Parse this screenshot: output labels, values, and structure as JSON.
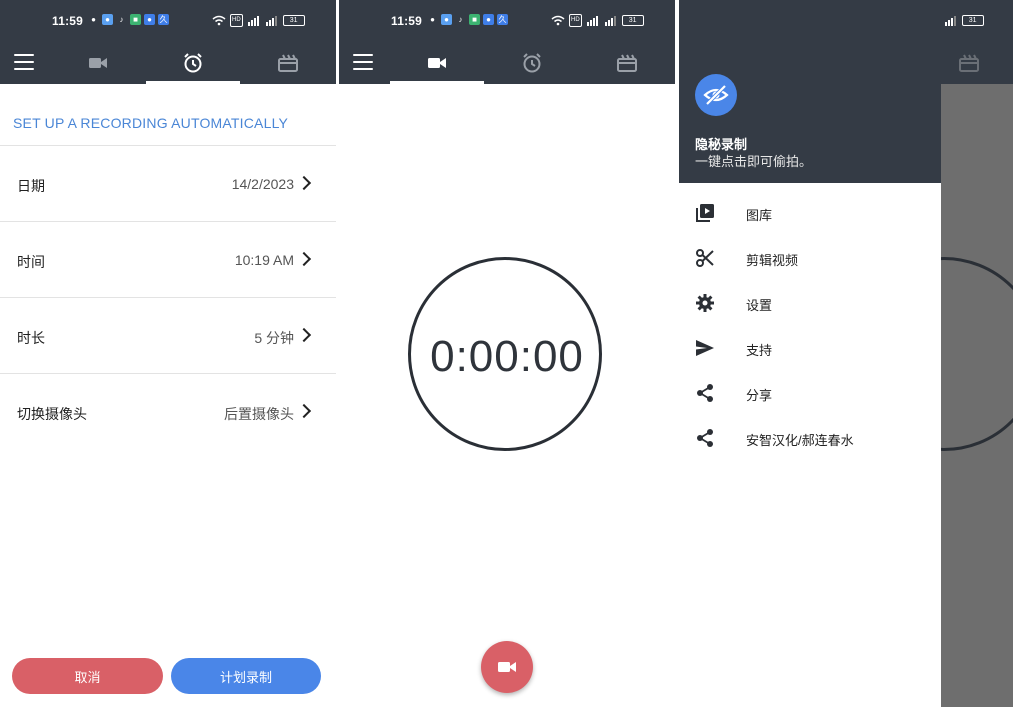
{
  "colors": {
    "toolbar": "#343b45",
    "accent": "#4a86d6",
    "red": "#d96067",
    "blue": "#4a86e8"
  },
  "status": {
    "time": "11:59",
    "battery": "31",
    "hd": "HD"
  },
  "schedule": {
    "heading": "SET UP A RECORDING AUTOMATICALLY",
    "rows": [
      {
        "label": "日期",
        "value": "14/2/2023"
      },
      {
        "label": "时间",
        "value": "10:19 AM"
      },
      {
        "label": "时长",
        "value": "5 分钟"
      },
      {
        "label": "切换摄像头",
        "value": "后置摄像头"
      }
    ],
    "cancel_label": "取消",
    "plan_label": "计划录制"
  },
  "recorder": {
    "timer": "0:00:00"
  },
  "drawer": {
    "title": "隐秘录制",
    "subtitle": "一键点击即可偷拍。",
    "items": [
      {
        "label": "图库",
        "icon": "gallery-icon"
      },
      {
        "label": "剪辑视频",
        "icon": "scissors-icon"
      },
      {
        "label": "设置",
        "icon": "gear-icon"
      },
      {
        "label": "支持",
        "icon": "send-icon"
      },
      {
        "label": "分享",
        "icon": "share-icon"
      },
      {
        "label": "安智汉化/郝连春水",
        "icon": "share-icon"
      }
    ]
  }
}
